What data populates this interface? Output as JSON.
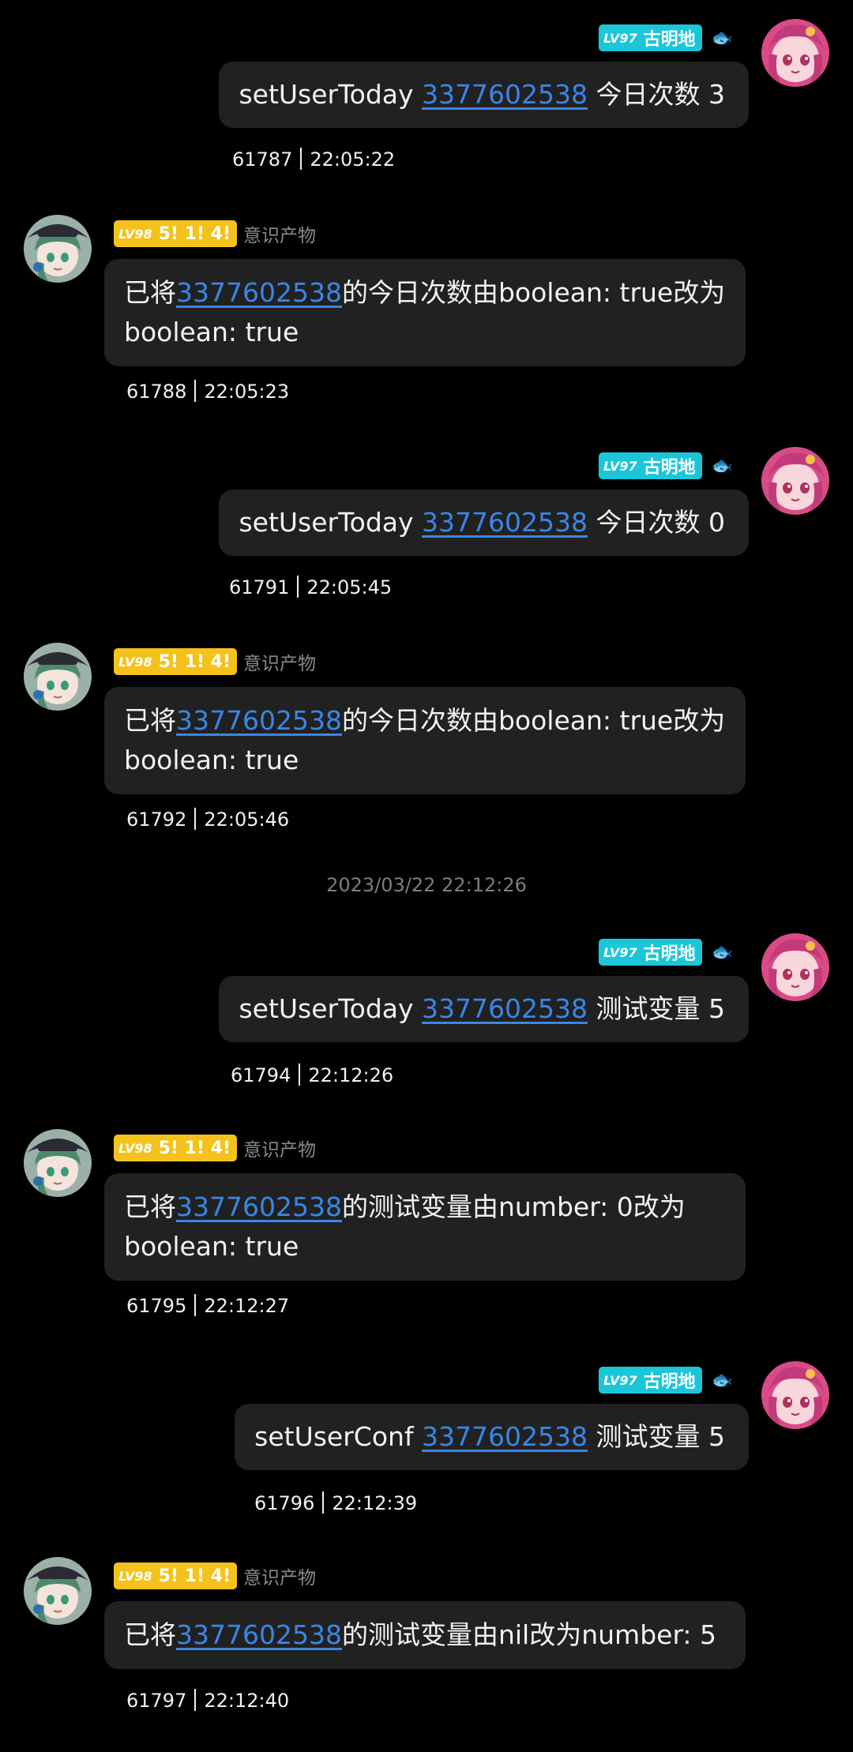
{
  "colors": {
    "background": "#000000",
    "bubble": "#212121",
    "link": "#3a86e6",
    "badge_user": "#1bc6d9",
    "badge_bot": "#f4c21b"
  },
  "user": {
    "level": "LV97",
    "title": "古明地",
    "extra_icon": "fish-icon"
  },
  "bot": {
    "level": "LV98",
    "title": "5! 1! 4!",
    "name": "意识产物"
  },
  "messages": [
    {
      "id": "m1",
      "side": "me",
      "pre": "setUserToday ",
      "link": "3377602538",
      "post": " 今日次数 3",
      "msg_id": "61787",
      "time": "22:05:22"
    },
    {
      "id": "m2",
      "side": "bot",
      "pre": "已将",
      "link": "3377602538",
      "post": "的今日次数由boolean: true改为boolean: true",
      "msg_id": "61788",
      "time": "22:05:23"
    },
    {
      "id": "m3",
      "side": "me",
      "pre": "setUserToday ",
      "link": "3377602538",
      "post": " 今日次数 0",
      "msg_id": "61791",
      "time": "22:05:45"
    },
    {
      "id": "m4",
      "side": "bot",
      "pre": "已将",
      "link": "3377602538",
      "post": "的今日次数由boolean: true改为boolean: true",
      "msg_id": "61792",
      "time": "22:05:46"
    },
    {
      "id": "m5",
      "side": "me",
      "pre": "setUserToday ",
      "link": "3377602538",
      "post": " 测试变量 5",
      "msg_id": "61794",
      "time": "22:12:26"
    },
    {
      "id": "m6",
      "side": "bot",
      "pre": "已将",
      "link": "3377602538",
      "post": "的测试变量由number: 0改为boolean: true",
      "msg_id": "61795",
      "time": "22:12:27"
    },
    {
      "id": "m7",
      "side": "me",
      "pre": "setUserConf ",
      "link": "3377602538",
      "post": " 测试变量 5",
      "msg_id": "61796",
      "time": "22:12:39"
    },
    {
      "id": "m8",
      "side": "bot",
      "pre": "已将",
      "link": "3377602538",
      "post": "的测试变量由nil改为number: 5",
      "msg_id": "61797",
      "time": "22:12:40"
    }
  ],
  "time_separator": "2023/03/22 22:12:26"
}
